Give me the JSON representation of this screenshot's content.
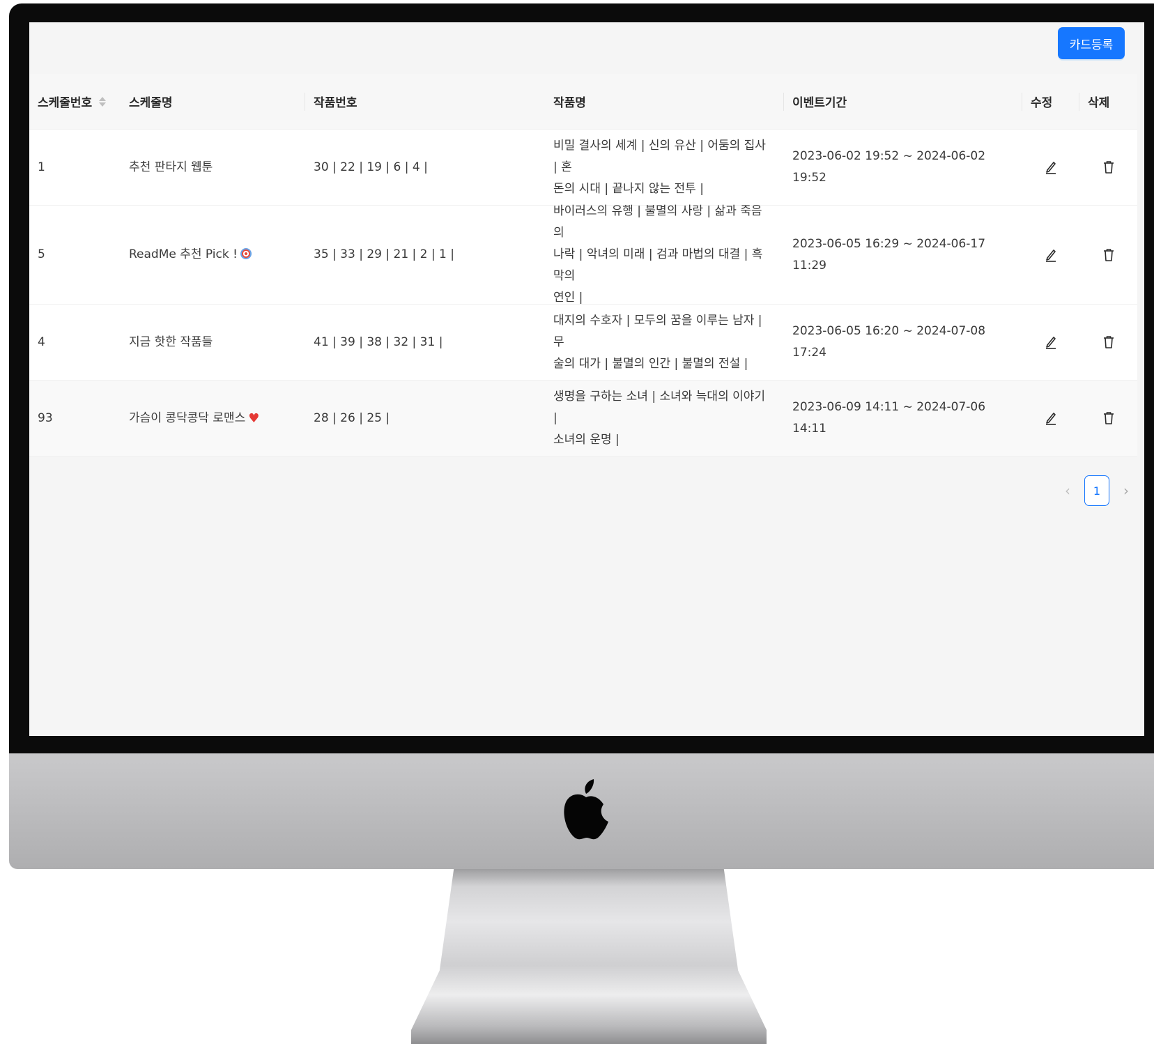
{
  "toolbar": {
    "register_label": "카드등록"
  },
  "table": {
    "columns": {
      "schedule_no": "스케줄번호",
      "schedule_name": "스케줄명",
      "work_numbers": "작품번호",
      "work_names": "작품명",
      "event_period": "이벤트기간",
      "edit": "수정",
      "delete": "삭제"
    },
    "rows": [
      {
        "schedule_no": "1",
        "schedule_name": "추천 판타지 웹툰",
        "schedule_emoji": "",
        "work_numbers": "30 | 22 | 19 | 6 | 4 |",
        "work_names_lines": [
          "비밀 결사의 세계 | 신의 유산 | 어둠의 집사 | 혼",
          "돈의 시대 | 끝나지 않는 전투 |"
        ],
        "event_period": "2023-06-02 19:52 ~ 2024-06-02 19:52"
      },
      {
        "schedule_no": "5",
        "schedule_name": "ReadMe 추천 Pick !",
        "schedule_emoji": "target-emoji",
        "work_numbers": "35 | 33 | 29 | 21 | 2 | 1 |",
        "work_names_lines": [
          "바이러스의 유행 | 불멸의 사랑 | 삶과 죽음의",
          "나락 | 악녀의 미래 | 검과 마법의 대결 | 흑막의",
          "연인 |"
        ],
        "event_period": "2023-06-05 16:29 ~ 2024-06-17 11:29"
      },
      {
        "schedule_no": "4",
        "schedule_name": "지금 핫한 작품들",
        "schedule_emoji": "",
        "work_numbers": "41 | 39 | 38 | 32 | 31 |",
        "work_names_lines": [
          "대지의 수호자 | 모두의 꿈을 이루는 남자 | 무",
          "술의 대가 | 불멸의 인간 | 불멸의 전설 |"
        ],
        "event_period": "2023-06-05 16:20 ~ 2024-07-08 17:24"
      },
      {
        "schedule_no": "93",
        "schedule_name": "가슴이 콩닥콩닥 로맨스",
        "schedule_emoji": "heart-emoji",
        "work_numbers": "28 | 26 | 25 |",
        "work_names_lines": [
          "생명을 구하는 소녀 | 소녀와 늑대의 이야기 |",
          "소녀의 운명 |"
        ],
        "event_period": "2023-06-09 14:11 ~ 2024-07-06 14:11"
      }
    ]
  },
  "pagination": {
    "prev": "‹",
    "current_page": "1",
    "next": "›"
  },
  "icons": {
    "edit": "edit-icon",
    "delete": "delete-icon",
    "sort": "sort-icon",
    "brand": "apple-logo-icon"
  },
  "colors": {
    "accent": "#1677ff",
    "heart": "#e53935"
  }
}
